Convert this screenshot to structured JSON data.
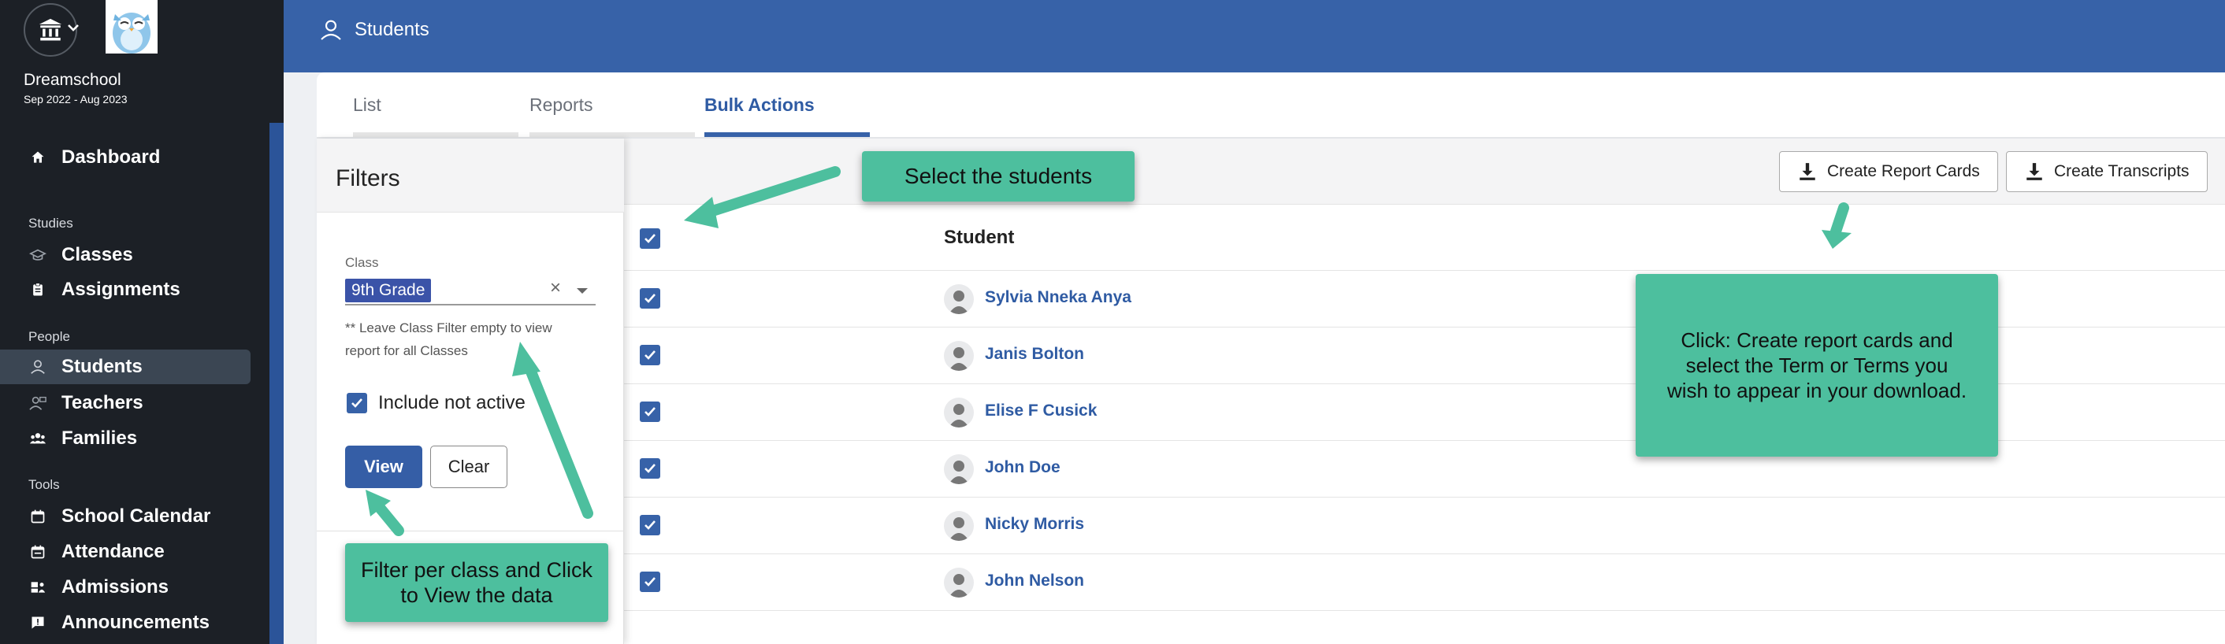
{
  "app": {
    "school_name": "Dreamschool",
    "school_dates": "Sep 2022 - Aug 2023"
  },
  "sidebar": {
    "dashboard": "Dashboard",
    "sections": {
      "studies": "Studies",
      "people": "People",
      "tools": "Tools"
    },
    "items": [
      {
        "label": "Classes",
        "icon": "mortarboard-icon"
      },
      {
        "label": "Assignments",
        "icon": "clipboard-icon"
      },
      {
        "label": "Students",
        "icon": "person-icon",
        "active": true
      },
      {
        "label": "Teachers",
        "icon": "teacher-icon"
      },
      {
        "label": "Families",
        "icon": "group-icon"
      },
      {
        "label": "School Calendar",
        "icon": "calendar-icon"
      },
      {
        "label": "Attendance",
        "icon": "calendar-check-icon"
      },
      {
        "label": "Admissions",
        "icon": "admissions-icon"
      },
      {
        "label": "Announcements",
        "icon": "announcement-icon"
      }
    ]
  },
  "header": {
    "title": "Students"
  },
  "tabs": [
    "List",
    "Reports",
    "Bulk Actions"
  ],
  "active_tab": "Bulk Actions",
  "filters": {
    "title": "Filters",
    "class_label": "Class",
    "class_value": "9th Grade",
    "class_help": "** Leave Class Filter empty to view report for all Classes",
    "include_not_active_label": "Include not active",
    "include_not_active_checked": true,
    "view_label": "View",
    "clear_label": "Clear"
  },
  "toolbar": {
    "create_report_cards": "Create Report Cards",
    "create_transcripts": "Create Transcripts"
  },
  "table": {
    "header": "Student",
    "rows": [
      "Sylvia Nneka Anya",
      "Janis Bolton",
      "Elise F Cusick",
      "John Doe",
      "Nicky Morris",
      "John Nelson"
    ]
  },
  "callouts": {
    "select_students": "Select the students",
    "create_report": "Click: Create report cards and select the Term or Terms you wish to appear in your download.",
    "filter_class": "Filter per class and Click to View the data"
  },
  "colors": {
    "sidebar_bg": "#1c2026",
    "header_bg": "#3762a8",
    "accent": "#3762a8",
    "callout": "#4dbf9e",
    "link": "#2f5ba3"
  }
}
